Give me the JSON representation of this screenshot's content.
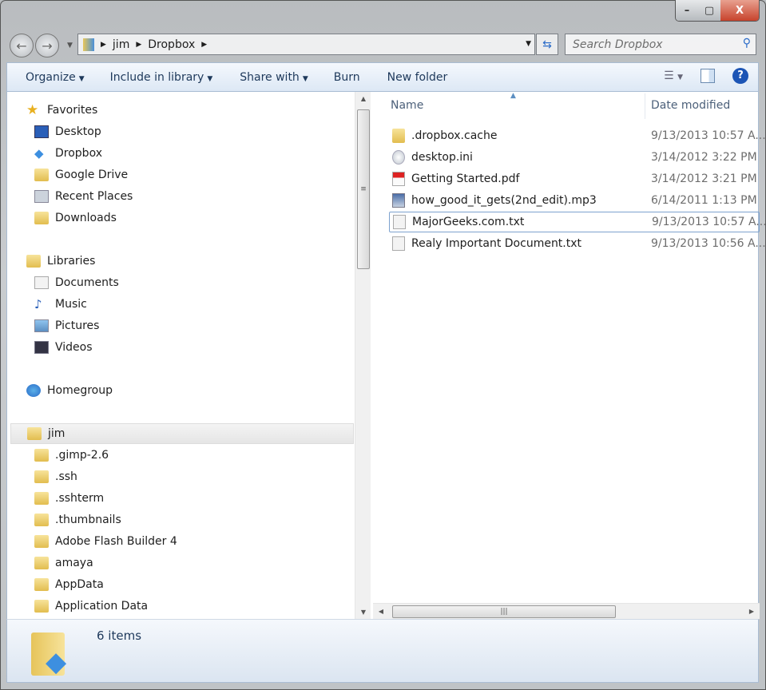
{
  "window": {
    "minimize": "–",
    "maximize": "▢",
    "close": "X"
  },
  "address": {
    "crumbs": [
      "jim",
      "Dropbox"
    ],
    "search_placeholder": "Search Dropbox"
  },
  "toolbar": {
    "organize": "Organize",
    "include": "Include in library",
    "share": "Share with",
    "burn": "Burn",
    "new_folder": "New folder",
    "help": "?"
  },
  "nav": {
    "favorites": {
      "label": "Favorites",
      "items": [
        "Desktop",
        "Dropbox",
        "Google Drive",
        "Recent Places",
        "Downloads"
      ]
    },
    "libraries": {
      "label": "Libraries",
      "items": [
        "Documents",
        "Music",
        "Pictures",
        "Videos"
      ]
    },
    "homegroup": "Homegroup",
    "user": {
      "label": "jim",
      "items": [
        ".gimp-2.6",
        ".ssh",
        ".sshterm",
        ".thumbnails",
        "Adobe Flash Builder 4",
        "amaya",
        "AppData",
        "Application Data"
      ]
    }
  },
  "columns": {
    "name": "Name",
    "date": "Date modified"
  },
  "files": [
    {
      "name": ".dropbox.cache",
      "date": "9/13/2013 10:57 A...",
      "icon": "folder-icon"
    },
    {
      "name": "desktop.ini",
      "date": "3/14/2012 3:22 PM",
      "icon": "settings-file-icon"
    },
    {
      "name": "Getting Started.pdf",
      "date": "3/14/2012 3:21 PM",
      "icon": "pdf-icon"
    },
    {
      "name": "how_good_it_gets(2nd_edit).mp3",
      "date": "6/14/2011 1:13 PM",
      "icon": "audio-file-icon"
    },
    {
      "name": "MajorGeeks.com.txt",
      "date": "9/13/2013 10:57 A...",
      "icon": "text-file-icon"
    },
    {
      "name": "Realy Important Document.txt",
      "date": "9/13/2013 10:56 A...",
      "icon": "text-file-icon"
    }
  ],
  "status": {
    "count": "6 items"
  }
}
